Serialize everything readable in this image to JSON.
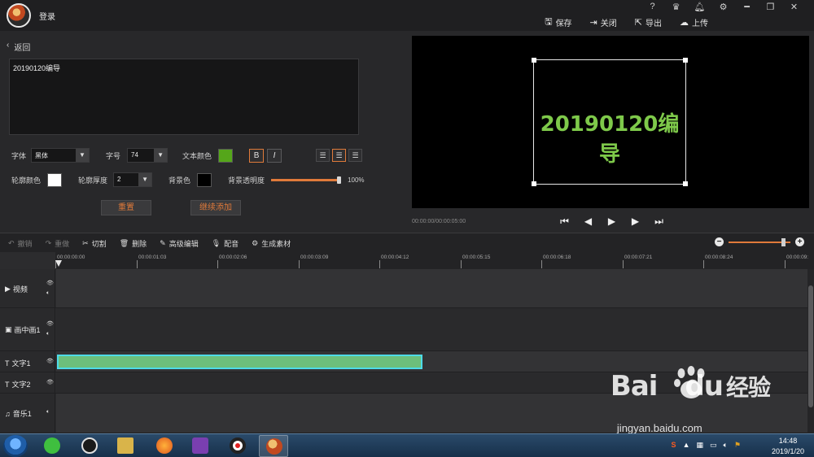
{
  "titlebar": {
    "title": "登录",
    "icons": [
      "?",
      "VIP",
      "bell-icon",
      "gear-icon",
      "minimize",
      "restore",
      "close"
    ],
    "actions": [
      {
        "icon": "save-icon",
        "label": "保存"
      },
      {
        "icon": "exit-icon",
        "label": "关闭"
      },
      {
        "icon": "export-icon",
        "label": "导出"
      },
      {
        "icon": "upload-icon",
        "label": "上传"
      }
    ]
  },
  "editor": {
    "back_label": "返回",
    "text_value": "20190120编导",
    "font_label": "字体",
    "font_value": "黑体",
    "size_label": "字号",
    "size_value": "74",
    "text_color_label": "文本颜色",
    "text_color": "#55a61a",
    "bold_label": "B",
    "italic_label": "I",
    "outline_color_label": "轮廓颜色",
    "outline_color": "#ffffff",
    "outline_width_label": "轮廓厚度",
    "outline_width_value": "2",
    "bg_color_label": "背景色",
    "bg_color": "#000000",
    "bg_opacity_label": "背景透明度",
    "bg_opacity_value": "100%",
    "reset_label": "重置",
    "add_label": "继续添加"
  },
  "preview": {
    "overlay_text": "20190120编导",
    "time": "00:00:00/00:00:05:00"
  },
  "toolbar": {
    "undo": "撤销",
    "redo": "重做",
    "cut": "切割",
    "delete": "删除",
    "advanced": "高级编辑",
    "dub": "配音",
    "generate": "生成素材"
  },
  "timeline": {
    "ticks": [
      "00:00:00:00",
      "00:00:01:03",
      "00:00:02:06",
      "00:00:03:09",
      "00:00:04:12",
      "00:00:05:15",
      "00:00:06:18",
      "00:00:07:21",
      "00:00:08:24",
      "00:00:09:"
    ],
    "tracks": [
      "视频",
      "画中画1",
      "文字1",
      "文字2",
      "音乐1"
    ]
  },
  "taskbar": {
    "time": "14:48",
    "date": "2019/1/20"
  },
  "watermark": {
    "brand_a": "Bai",
    "brand_b": "du",
    "brand_c": "经验",
    "url": "jingyan.baidu.com"
  }
}
